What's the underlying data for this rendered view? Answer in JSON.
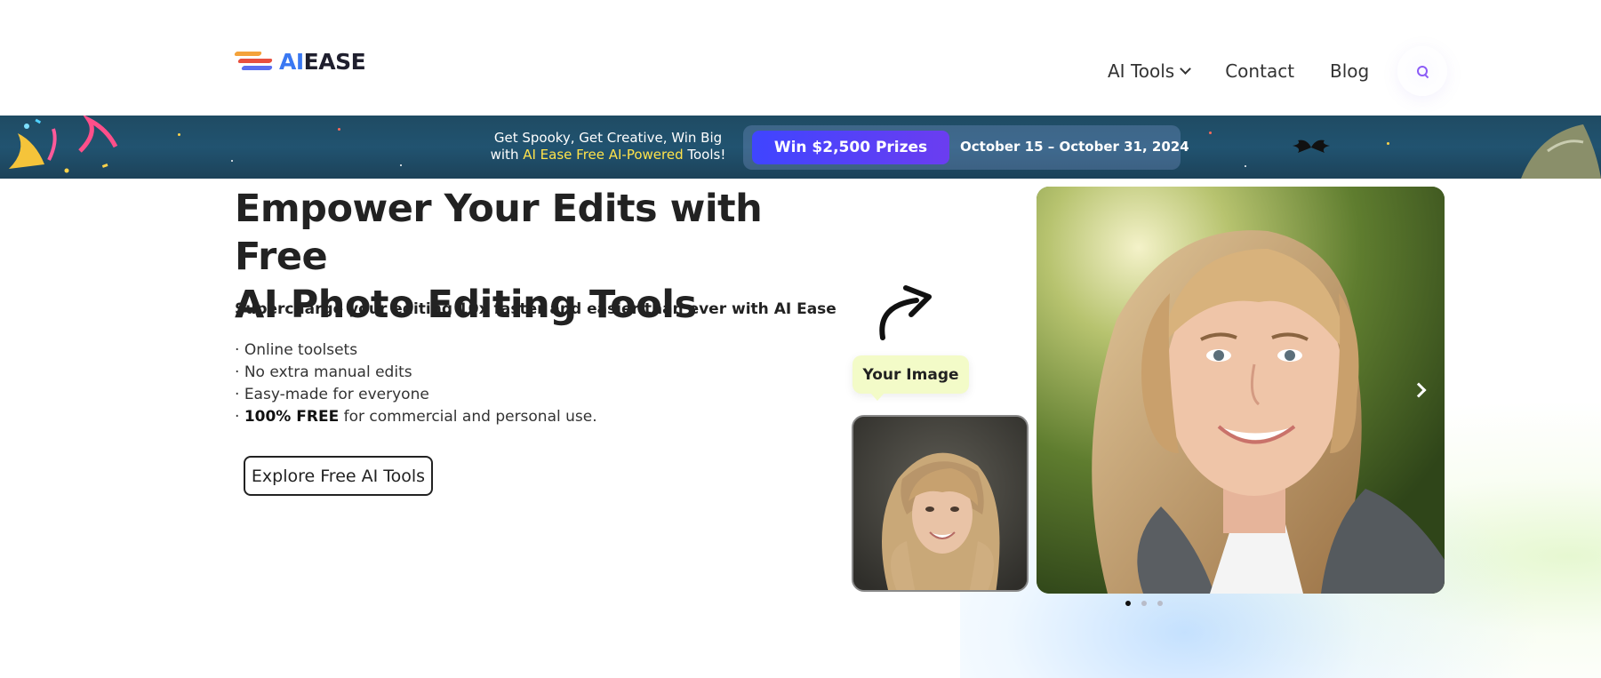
{
  "header": {
    "logo": {
      "ai": "AI",
      "ease": "EASE"
    },
    "nav": [
      {
        "label": "AI Tools",
        "has_dropdown": true
      },
      {
        "label": "Contact"
      },
      {
        "label": "Blog"
      }
    ],
    "search_icon": "search-icon"
  },
  "banner": {
    "line1": "Get Spooky, Get Creative, Win Big",
    "line2_prefix": "with ",
    "line2_highlight": "AI Ease Free AI-Powered",
    "line2_suffix": " Tools!",
    "prize": "Win $2,500 Prizes",
    "dates": "October 15 – October 31, 2024",
    "highlight_color": "#ffe34a"
  },
  "hero": {
    "title_line1": "Empower Your Edits with Free",
    "title_line2": "AI Photo Editing Tools",
    "subtitle": "Supercharge your editing 10x faster and easier than ever with AI Ease",
    "features": [
      "Online toolsets",
      "No extra manual edits",
      "Easy-made for everyone"
    ],
    "feature_last_bold": "100% FREE",
    "feature_last_rest": " for commercial and personal use.",
    "cta_label": "Explore Free AI Tools"
  },
  "showcase": {
    "input_label": "Your Image",
    "next_icon": "chevron-right-icon",
    "carousel_count": 3,
    "carousel_active": 0
  }
}
